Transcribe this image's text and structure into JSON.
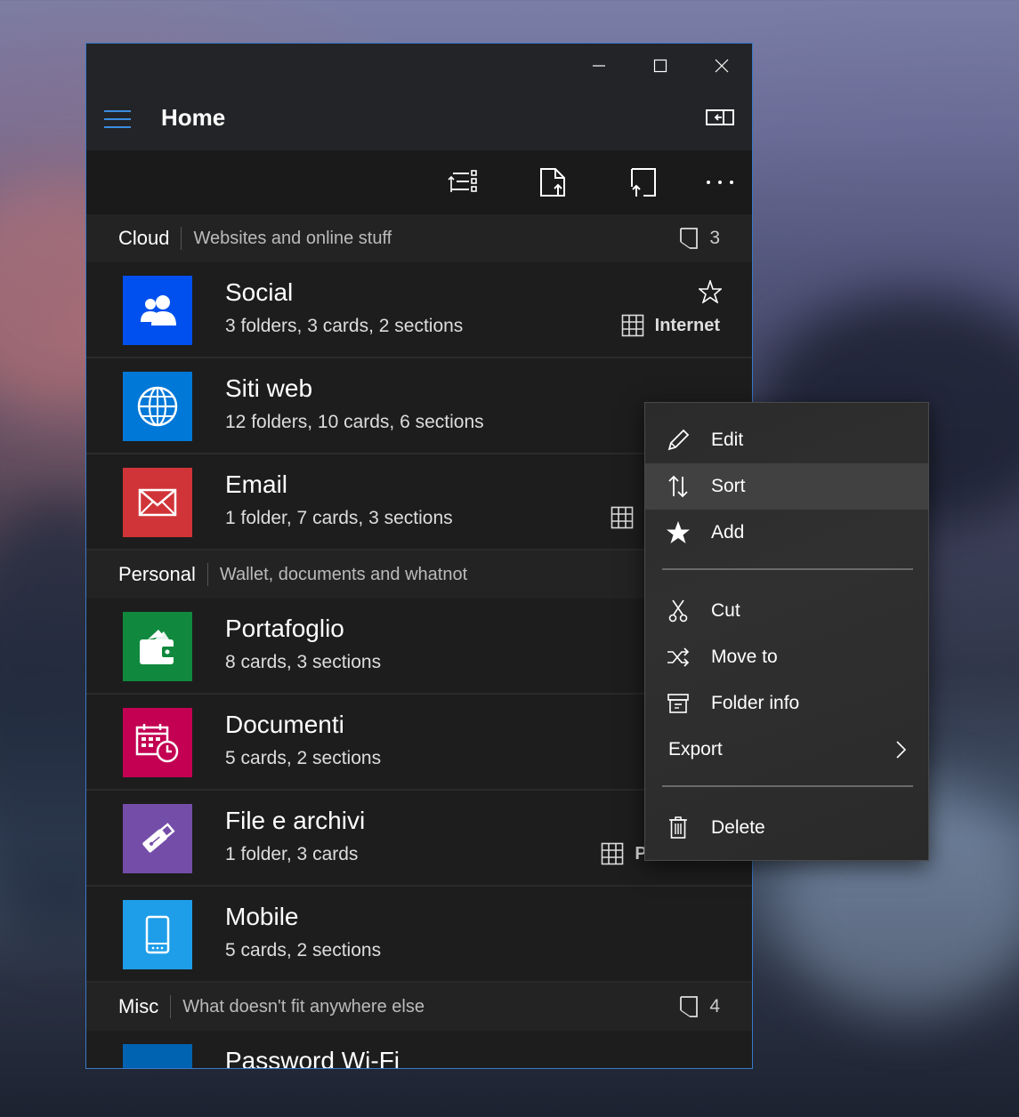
{
  "window": {
    "title": "Home",
    "caption_buttons": [
      "minimize-icon",
      "maximize-icon",
      "close-icon"
    ]
  },
  "toolbar": {
    "buttons": [
      "filter-icon",
      "export-card-icon",
      "import-card-icon",
      "more-icon"
    ],
    "more_label": "..."
  },
  "groups": [
    {
      "name": "Cloud",
      "description": "Websites and online stuff",
      "count": "3",
      "items": [
        {
          "name": "Social",
          "details": "3 folders, 3 cards, 2 sections",
          "tag": "Internet",
          "starred": true,
          "color": "#0050ef",
          "icon": "people-icon"
        },
        {
          "name": "Siti web",
          "details": "12 folders, 10 cards, 6 sections",
          "tag": "",
          "starred": false,
          "color": "#0078d7",
          "icon": "globe-icon"
        },
        {
          "name": "Email",
          "details": "1 folder, 7 cards, 3 sections",
          "tag": "P",
          "starred": false,
          "color": "#d13438",
          "icon": "mail-icon"
        }
      ]
    },
    {
      "name": "Personal",
      "description": "Wallet, documents and whatnot",
      "count": "",
      "items": [
        {
          "name": "Portafoglio",
          "details": "8 cards, 3 sections",
          "tag": "",
          "starred": false,
          "color": "#10893e",
          "icon": "wallet-icon"
        },
        {
          "name": "Documenti",
          "details": "5 cards, 2 sections",
          "tag": "",
          "starred": false,
          "color": "#c30052",
          "icon": "calendar-clock-icon"
        },
        {
          "name": "File e archivi",
          "details": "1 folder, 3 cards",
          "tag": "Personale",
          "starred": false,
          "color": "#744da9",
          "icon": "usb-icon"
        },
        {
          "name": "Mobile",
          "details": "5 cards, 2 sections",
          "tag": "",
          "starred": false,
          "color": "#1e9ee8",
          "icon": "phone-icon"
        }
      ]
    },
    {
      "name": "Misc",
      "description": "What doesn't fit anywhere else",
      "count": "4",
      "items": [
        {
          "name": "Password Wi-Fi",
          "details": "",
          "tag": "",
          "starred": false,
          "color": "#0063b1",
          "icon": "wifi-icon"
        }
      ]
    }
  ],
  "context_menu": {
    "items": [
      {
        "label": "Edit",
        "icon": "pencil-icon"
      },
      {
        "label": "Sort",
        "icon": "sort-icon",
        "highlighted": true
      },
      {
        "label": "Add",
        "icon": "star-icon"
      },
      {
        "label": "Cut",
        "icon": "scissors-icon"
      },
      {
        "label": "Move to",
        "icon": "shuffle-icon"
      },
      {
        "label": "Folder info",
        "icon": "archive-icon"
      },
      {
        "label": "Export",
        "icon": "",
        "submenu": true
      },
      {
        "label": "Delete",
        "icon": "trash-icon"
      }
    ]
  }
}
